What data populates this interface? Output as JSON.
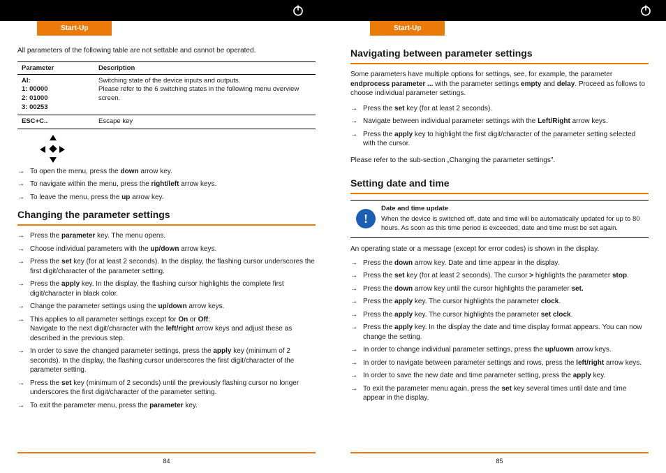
{
  "sectionTab": "Start-Up",
  "left": {
    "intro": "All parameters of the following table are not settable and cannot be operated.",
    "table": {
      "headers": [
        "Parameter",
        "Description"
      ],
      "rows": [
        {
          "param": "AI:\n1: 00000\n2: 01000\n3: 00253",
          "desc": "Switching state of the device inputs and outputs.\nPlease refer to the 6 switching states in the following menu overview screen."
        },
        {
          "param": "ESC+C..",
          "desc": "Escape key"
        }
      ]
    },
    "menuNav": [
      "To open the menu, press the <b>down</b> arrow key.",
      "To navigate within the menu, press the <b>right/left</b> arrow keys.",
      "To leave the menu, press the <b>up</b> arrow key."
    ],
    "heading1": "Changing the parameter settings",
    "changeList": [
      "Press the <b>parameter</b> key. The menu opens.",
      "Choose individual parameters with the <b>up/down</b> arrow keys.",
      "Press the <b>set</b> key (for at least 2 seconds). In the display, the flashing cursor underscores the first digit/character of the parameter setting.",
      "Press the <b>apply</b> key. In the display, the flashing cursor highlights the complete first digit/character in black color.",
      "Change the parameter settings using the <b>up/down</b> arrow keys.",
      "This applies to all parameter settings except for <b>On</b> or <b>Off</b>:<br>Navigate to the next digit/character with the <b>left/right</b> arrow keys and adjust these as described in the previous step.",
      "In order to save the changed parameter settings, press the <b>apply</b> key (minimum of 2 seconds). In the display, the flashing cursor underscores the first digit/character of the parameter setting.",
      "Press the <b>set</b> key (minimum of 2 seconds) until the previously flashing cursor no longer underscores the first digit/character of the parameter setting.",
      "To exit the parameter menu, press the <b>parameter</b> key."
    ],
    "pageNumber": "84"
  },
  "right": {
    "heading1": "Navigating between parameter settings",
    "navIntro": "Some parameters have multiple options for settings, see, for example, the parameter <b>endprocess parameter ...</b> with the parameter settings <b>empty</b> and <b>delay</b>. Proceed as follows to choose individual parameter settings.",
    "navList": [
      "Press the <b>set</b> key (for at least 2 seconds).",
      "Navigate between individual parameter settings with the <b>Left/Right</b> arrow keys.",
      "Press the <b>apply</b> key to highlight the first digit/character of the parameter setting selected with the cursor."
    ],
    "navFooter": "Please refer to the sub-section „Changing the parameter settings\".",
    "heading2": "Setting date and time",
    "note": {
      "title": "Date and time update",
      "body": "When the device is switched off, date and time will be automatically updated for up to 80 hours. As soon as this time period is exceeded, date and time must be set again."
    },
    "dateIntro": "An operating state or a message (except for error codes) is shown in the display.",
    "dateList": [
      "Press the <b>down</b> arrow key. Date and time appear in the display.",
      "Press the <b>set</b> key (for at least 2 seconds). The cursor <b>&gt;</b> highlights the parameter <b>stop</b>.",
      "Press the <b>down</b> arrow key until the cursor highlights the parameter <b>set.</b>",
      "Press the <b>apply</b> key. The cursor highlights the parameter <b>clock</b>.",
      "Press the <b>apply</b> key. The cursor highlights the parameter <b>set clock</b>.",
      "Press the <b>apply</b> key. In the display the date and time display format appears. You can now change the setting.",
      "In order to change individual parameter settings, press the <b>up/uown</b> arrow keys.",
      "In order to navigate between parameter settings and rows, press the <b>left/right</b> arrow keys.",
      "In order to save the new date and time parameter setting, press the <b>apply</b> key.",
      "To exit the parameter menu again, press the <b>set</b> key several times until date and time appear in the display."
    ],
    "pageNumber": "85"
  }
}
